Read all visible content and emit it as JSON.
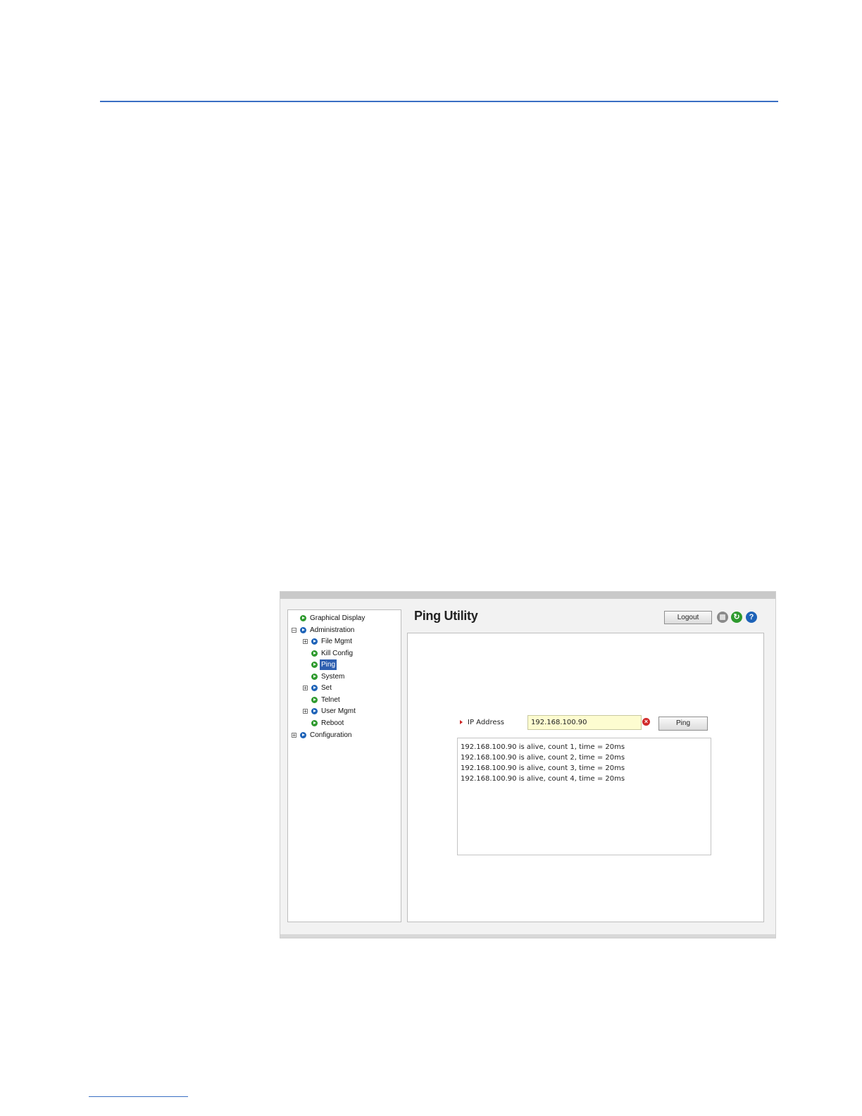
{
  "nav": {
    "items": [
      {
        "label": "Graphical Display",
        "expander": "",
        "icon": "green"
      },
      {
        "label": "Administration",
        "expander": "−",
        "icon": "blue"
      },
      {
        "label": "File Mgmt",
        "expander": "+",
        "icon": "blue"
      },
      {
        "label": "Kill Config",
        "expander": "",
        "icon": "green"
      },
      {
        "label": "Ping",
        "expander": "",
        "icon": "green",
        "selected": true
      },
      {
        "label": "System",
        "expander": "",
        "icon": "green"
      },
      {
        "label": "Set",
        "expander": "+",
        "icon": "blue"
      },
      {
        "label": "Telnet",
        "expander": "",
        "icon": "green"
      },
      {
        "label": "User Mgmt",
        "expander": "+",
        "icon": "blue"
      },
      {
        "label": "Reboot",
        "expander": "",
        "icon": "green"
      },
      {
        "label": "Configuration",
        "expander": "+",
        "icon": "blue"
      }
    ]
  },
  "header": {
    "title": "Ping Utility",
    "logout_label": "Logout",
    "icons": [
      "save-icon",
      "refresh-icon",
      "help-icon"
    ]
  },
  "form": {
    "ip_label": "IP Address",
    "ip_value": "192.168.100.90",
    "ping_label": "Ping"
  },
  "output": {
    "lines": [
      "192.168.100.90 is alive, count 1, time = 20ms",
      "192.168.100.90 is alive, count 2, time = 20ms",
      "192.168.100.90 is alive, count 3, time = 20ms",
      "192.168.100.90 is alive, count 4, time = 20ms"
    ]
  },
  "colors": {
    "accent_rule": "#3a6fc4",
    "selected_bg": "#2e5fb0",
    "input_bg": "#fdfcd0"
  }
}
